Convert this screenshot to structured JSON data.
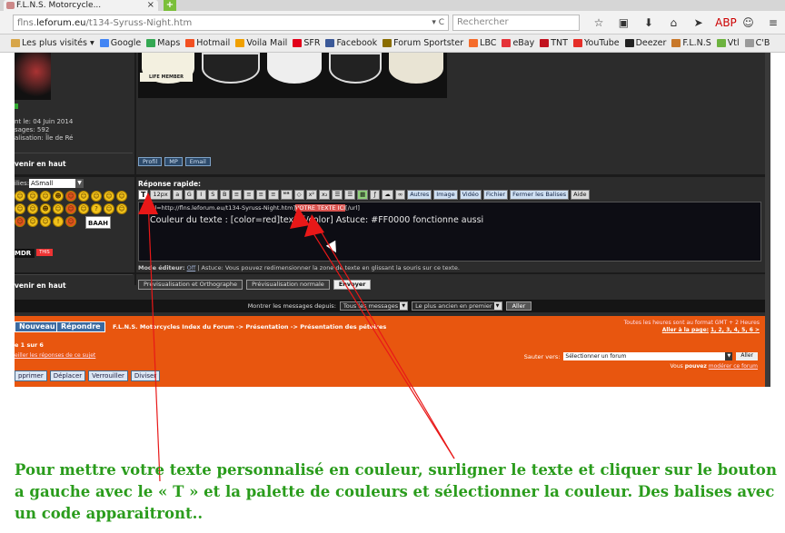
{
  "browser": {
    "tab_title": "F.L.N.S. Motorcycle...",
    "tab_close": "×",
    "new_tab": "+",
    "url_host": "flns.",
    "url_domain": "leforum.eu",
    "url_path": "/t134-Syruss-Night.htm",
    "url_controls": "▾ C",
    "search_placeholder": "Rechercher",
    "nav_icons": [
      "☆",
      "▣",
      "⬇",
      "⌂",
      "➤",
      "ABP",
      "☺",
      "≡"
    ],
    "bookmarks": [
      {
        "label": "Les plus visités ▾",
        "color": "#d7a64a"
      },
      {
        "label": "Google",
        "color": "#4285f4"
      },
      {
        "label": "Maps",
        "color": "#34a853"
      },
      {
        "label": "Hotmail",
        "color": "#f25022"
      },
      {
        "label": "Voila Mail",
        "color": "#f0a000"
      },
      {
        "label": "SFR",
        "color": "#e2001a"
      },
      {
        "label": "Facebook",
        "color": "#3b5998"
      },
      {
        "label": "Forum Sportster",
        "color": "#8a6d00"
      },
      {
        "label": "LBC",
        "color": "#f56b2a"
      },
      {
        "label": "eBay",
        "color": "#e53238"
      },
      {
        "label": "TNT",
        "color": "#c1121f"
      },
      {
        "label": "YouTube",
        "color": "#e52d27"
      },
      {
        "label": "Deezer",
        "color": "#222222"
      },
      {
        "label": "F.L.N.S",
        "color": "#c8782a"
      },
      {
        "label": "Vtl",
        "color": "#6db33f"
      },
      {
        "label": "C'B",
        "color": "#999999"
      }
    ]
  },
  "forum": {
    "user_info": [
      "nt le: 04 Juin 2014",
      "sages: 592",
      "alisation: Île de Ré"
    ],
    "back_to_top_1": "venir en haut",
    "back_to_top_2": "venir en haut",
    "signature": {
      "life_member": "LIFE MEMBER"
    },
    "profile_buttons": [
      "Profil",
      "MP",
      "Email"
    ],
    "smilies": {
      "label": "ilies:",
      "set": "ASmall",
      "icons": [
        "☺",
        "☺",
        "☺",
        "☻",
        "☺",
        "☺",
        "☺",
        "☺",
        "☺",
        "☺",
        "☺",
        "☻",
        "☺",
        "☺",
        "☺",
        "?",
        "☺",
        "☺",
        "☺",
        "☺",
        "☺",
        "!",
        "☺"
      ],
      "blaah": "BAAH",
      "mdr": "MDR",
      "mdr_tag": "THIS"
    },
    "quick_reply": {
      "label": "Réponse rapide:",
      "toolbar": [
        "T",
        "12px",
        "a",
        "G",
        "I",
        "S",
        "B",
        "≡",
        "≡",
        "≡",
        "≡",
        "❝❝",
        "◇",
        "x²",
        "x₂",
        "☰",
        "☰",
        "▦",
        "ƒ",
        "☁",
        "∞",
        "Autres",
        "Image",
        "Vidéo",
        "Fichier",
        "Fermer les Balises",
        "Aide"
      ],
      "editor_line1_before": "[url=http://flns.leforum.eu/t134-Syruss-Night.htm]",
      "editor_line1_highlight": "VOTRE TEXTE ICI",
      "editor_line1_after": "[/url]",
      "editor_line2": "Couleur du texte : [color=red]texte[/color] Astuce: #FF0000 fonctionne aussi",
      "mode_editor_label": "Mode éditeur:",
      "mode_editor_value": "Off",
      "mode_editor_tip": "| Astuce: Vous pouvez redimensionner la zone de texte en glissant la souris sur ce texte."
    },
    "preview_buttons": [
      "Prévisualisation et Orthographe",
      "Prévisualisation normale",
      "Envoyer"
    ],
    "show_messages": {
      "label": "Montrer les messages depuis:",
      "range": "Tous les messages",
      "order": "Le plus ancien en premier",
      "go": "Aller"
    },
    "bottom": {
      "new_button": "Nouveau",
      "reply_button": "Répondre",
      "breadcrumb": "F.L.N.S. Motorcycles Index du Forum -> Présentation -> Présentation des pétoires",
      "timezone": "Toutes les heures sont au format GMT + 2 Heures",
      "goto_page_label": "Aller à la page:",
      "goto_pages": "1, 2, 3, 4, 5, 6  >",
      "page_of": "e 1 sur 6",
      "watch": "eiller les réponses de ce sujet",
      "jump_label": "Sauter vers:",
      "jump_select": "Sélectionner un forum",
      "jump_go": "Aller",
      "can_moderate_before": "Vous",
      "can_moderate_bold": "pouvez",
      "can_moderate_link": "modérer ce forum",
      "mod_buttons": [
        "pprimer",
        "Déplacer",
        "Verrouiller",
        "Diviser"
      ]
    }
  },
  "caption": "Pour mettre votre texte personnalisé en couleur, surligner le texte et cliquer sur le bouton a gauche avec le « T » et la palette de couleurs et sélectionner la couleur. Des balises avec un code apparaitront..",
  "colors": {
    "forum_bg": "#2c2c2c",
    "orange_bar": "#e8560f",
    "arrow": "#e81818",
    "caption": "#2a9c1c"
  }
}
